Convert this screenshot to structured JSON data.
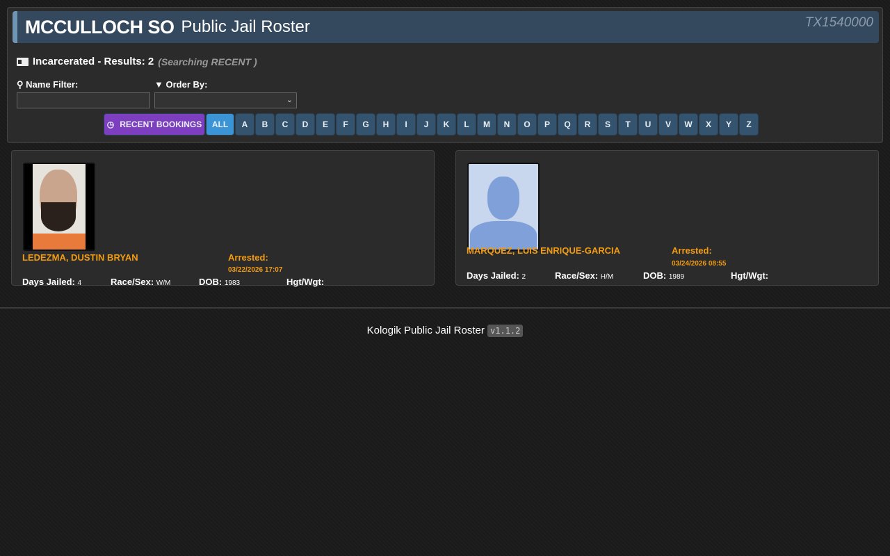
{
  "header": {
    "agency": "MCCULLOCH SO",
    "title": "Public Jail Roster",
    "code": "TX1540000"
  },
  "results": {
    "label": "Incarcerated - Results: 2",
    "searching": "(Searching RECENT )"
  },
  "filters": {
    "name_label": "Name Filter:",
    "name_value": "",
    "order_label": "Order By:",
    "order_value": ""
  },
  "buttons": {
    "recent": "RECENT BOOKINGS",
    "all": "ALL",
    "letters": [
      "A",
      "B",
      "C",
      "D",
      "E",
      "F",
      "G",
      "H",
      "I",
      "J",
      "K",
      "L",
      "M",
      "N",
      "O",
      "P",
      "Q",
      "R",
      "S",
      "T",
      "U",
      "V",
      "W",
      "X",
      "Y",
      "Z"
    ]
  },
  "inmates": [
    {
      "name": "LEDEZMA, DUSTIN BRYAN",
      "arrested_label": "Arrested:",
      "arrested": "03/22/2026 17:07",
      "days_label": "Days Jailed:",
      "days": "4",
      "race_label": "Race/Sex:",
      "race": "W/M",
      "dob_label": "DOB:",
      "dob": "1983",
      "hw_label": "Hgt/Wgt:",
      "hw": ""
    },
    {
      "name": "MARQUEZ, LUIS ENRIQUE-GARCIA",
      "arrested_label": "Arrested:",
      "arrested": "03/24/2026 08:55",
      "days_label": "Days Jailed:",
      "days": "2",
      "race_label": "Race/Sex:",
      "race": "H/M",
      "dob_label": "DOB:",
      "dob": "1989",
      "hw_label": "Hgt/Wgt:",
      "hw": ""
    }
  ],
  "footer": {
    "text": "Kologik Public Jail Roster",
    "version": "v1.1.2"
  }
}
